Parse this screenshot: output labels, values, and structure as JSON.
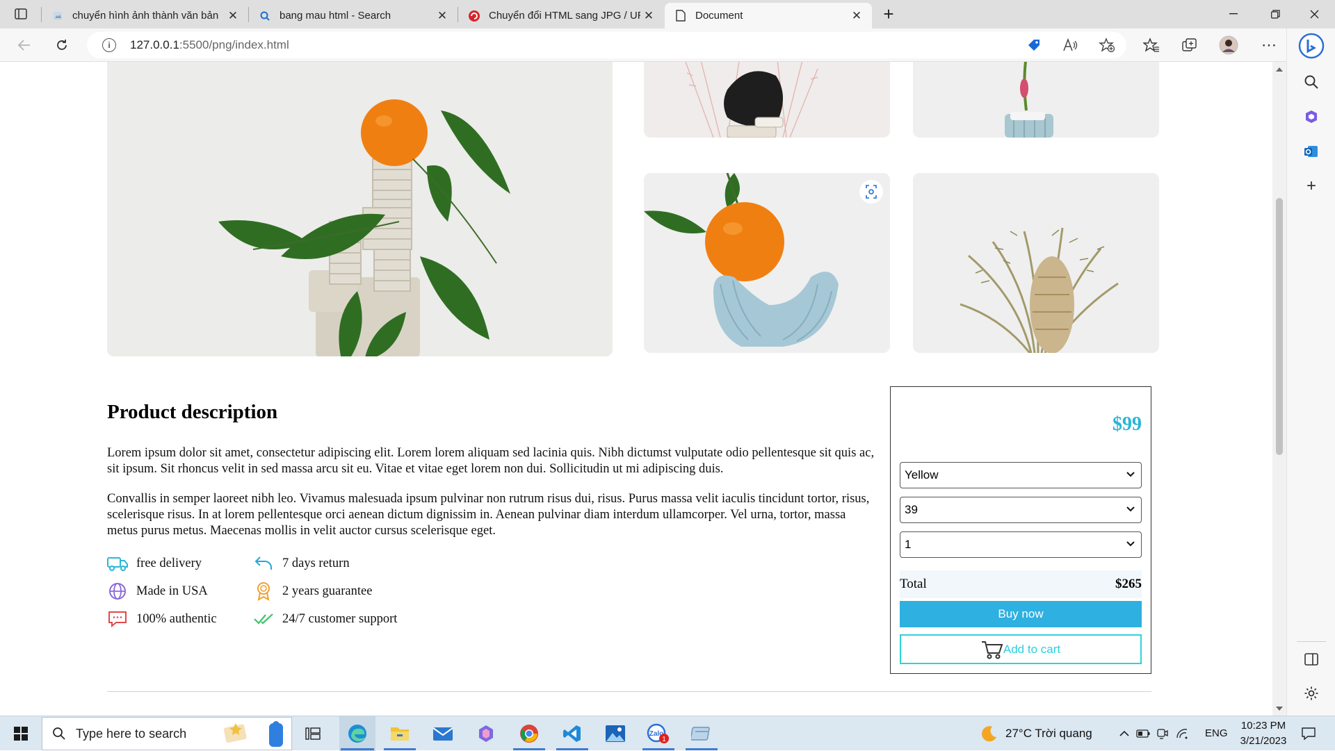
{
  "browser": {
    "tabs": [
      {
        "title": "chuyển hình ảnh thành văn bản",
        "active": false
      },
      {
        "title": "bang mau html - Search",
        "active": false
      },
      {
        "title": "Chuyển đổi HTML sang JPG / URL",
        "active": false
      },
      {
        "title": "Document",
        "active": true
      }
    ],
    "url_host": "127.0.0.1",
    "url_rest": ":5500/png/index.html"
  },
  "page": {
    "description": {
      "title": "Product description",
      "paragraph1": "Lorem ipsum dolor sit amet, consectetur adipiscing elit. Lorem lorem aliquam sed lacinia quis. Nibh dictumst vulputate odio pellentesque sit quis ac, sit ipsum. Sit rhoncus velit in sed massa arcu sit eu. Vitae et vitae eget lorem non dui. Sollicitudin ut mi adipiscing duis.",
      "paragraph2": "Convallis in semper laoreet nibh leo. Vivamus malesuada ipsum pulvinar non rutrum risus dui, risus. Purus massa velit iaculis tincidunt tortor, risus, scelerisque risus. In at lorem pellentesque orci aenean dictum dignissim in. Aenean pulvinar diam interdum ullamcorper. Vel urna, tortor, massa metus purus metus. Maecenas mollis in velit auctor cursus scelerisque eget."
    },
    "features": [
      {
        "label": "free delivery",
        "icon": "truck-icon"
      },
      {
        "label": "Made in USA",
        "icon": "globe-icon"
      },
      {
        "label": "100% authentic",
        "icon": "chat-icon"
      },
      {
        "label": "7 days return",
        "icon": "return-arrow-icon"
      },
      {
        "label": "2 years guarantee",
        "icon": "award-icon"
      },
      {
        "label": "24/7 customer support",
        "icon": "double-check-icon"
      }
    ],
    "buybox": {
      "price": "$99",
      "color_value": "Yellow",
      "size_value": "39",
      "quantity_value": "1",
      "total_label": "Total",
      "total_value": "$265",
      "buy_label": "Buy now",
      "cart_label": "Add to cart"
    },
    "accent_color": "#29b6d6",
    "buy_button_color": "#2eb0e0"
  },
  "taskbar": {
    "search_placeholder": "Type here to search",
    "weather": "27°C Trời quang",
    "language": "ENG",
    "time": "10:23 PM",
    "date": "3/21/2023",
    "zalo_badge": "1"
  }
}
